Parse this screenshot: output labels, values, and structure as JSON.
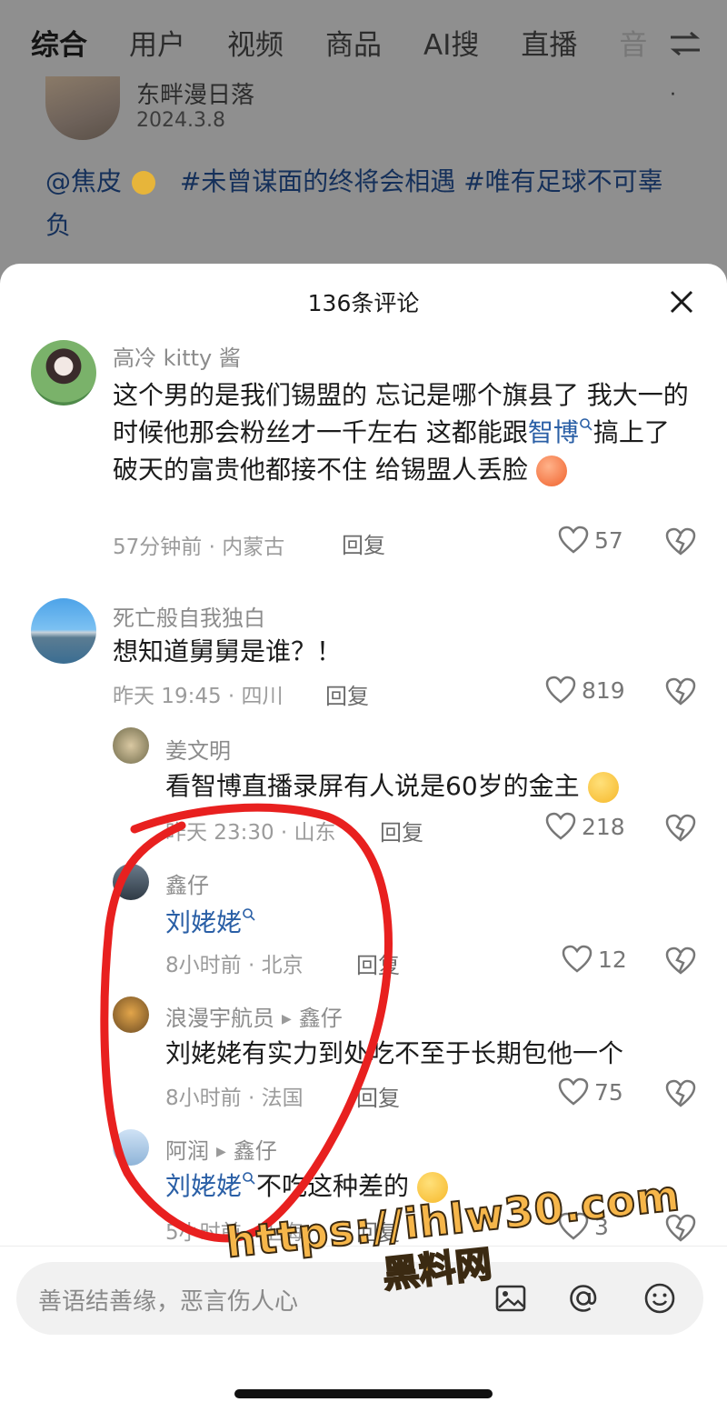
{
  "tabs": [
    "综合",
    "用户",
    "视频",
    "商品",
    "AI搜",
    "直播",
    "音"
  ],
  "post": {
    "username": "东畔漫日落",
    "date": "2024.3.8",
    "more": "·",
    "text_mention": "@焦皮",
    "text_tag1": "#未曾谋面的终将会相遇",
    "text_tag2": "#唯有足球不可辜负"
  },
  "sheet": {
    "title": "136条评论",
    "reply_label": "回复"
  },
  "comments": [
    {
      "user": "高冷 kitty 酱",
      "text_a": "这个男的是我们锡盟的 忘记是哪个旗县了 我大一的时候他那会粉丝才一千左右 这都能跟",
      "link": "智博",
      "text_b": "搞上了 破天的富贵他都接不住 给锡盟人丢脸",
      "meta": "57分钟前 · 内蒙古",
      "likes": "57"
    },
    {
      "user": "死亡般自我独白",
      "text": "想知道舅舅是谁？！",
      "meta": "昨天 19:45 · 四川",
      "likes": "819"
    },
    {
      "user": "姜文明",
      "text": "看智博直播录屏有人说是60岁的金主",
      "meta": "昨天 23:30 · 山东",
      "likes": "218"
    },
    {
      "user": "鑫仔",
      "link": "刘姥姥",
      "meta": "8小时前 · 北京",
      "likes": "12"
    },
    {
      "user": "浪漫宇航员",
      "reply_to": "鑫仔",
      "text": "刘姥姥有实力到处吃不至于长期包他一个",
      "meta": "8小时前 · 法国",
      "likes": "75"
    },
    {
      "user": "阿润",
      "reply_to": "鑫仔",
      "link": "刘姥姥",
      "text": "不吃这种差的",
      "meta": "5小时前 · 上海",
      "likes": "3"
    }
  ],
  "input": {
    "placeholder": "善语结善缘，恶言伤人心"
  },
  "watermark": {
    "url": "https://ihlw30.com",
    "name": "黑料网"
  },
  "colors": {
    "link": "#2a5fa6",
    "annotation": "#e8201f",
    "watermark": "#f6b64a"
  },
  "icons": [
    "filter-icon",
    "close-icon",
    "heart-icon",
    "broken-heart-icon",
    "image-icon",
    "at-icon",
    "emoji-icon",
    "search-icon"
  ]
}
